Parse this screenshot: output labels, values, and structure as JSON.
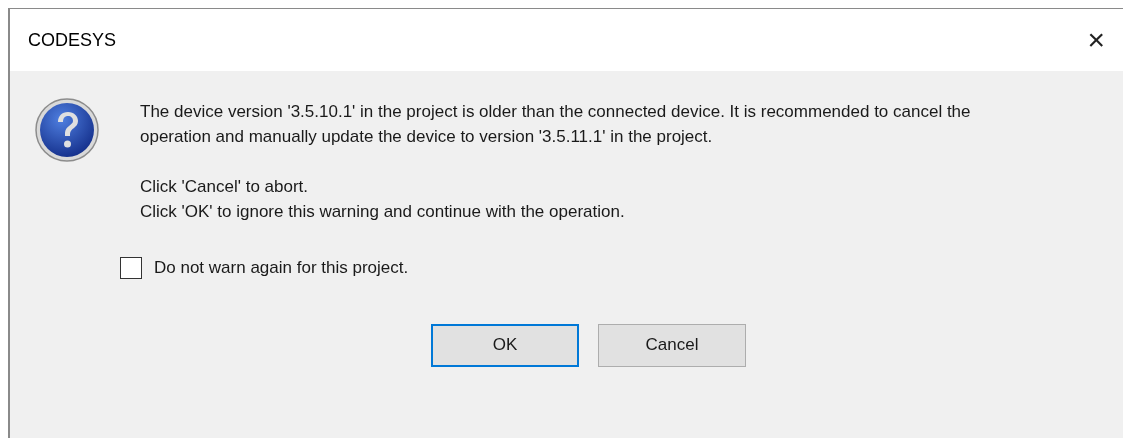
{
  "window": {
    "title": "CODESYS",
    "close": "×"
  },
  "message": "The device version '3.5.10.1' in the project is older than the connected device. It is recommended to cancel the operation and manually update the device to version '3.5.11.1' in the project.",
  "instructions": [
    "Click 'Cancel' to abort.",
    "Click 'OK' to ignore this warning and continue with the operation."
  ],
  "checkbox": {
    "label": "Do not warn again for this project.",
    "checked": false
  },
  "buttons": [
    {
      "label": "OK",
      "default": true
    },
    {
      "label": "Cancel",
      "default": false
    }
  ]
}
